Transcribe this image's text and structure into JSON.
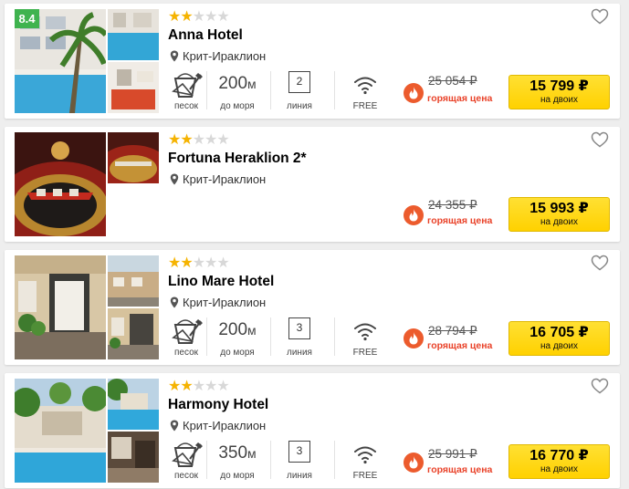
{
  "hotels": [
    {
      "rating": "8.4",
      "stars": 2,
      "name": "Anna Hotel",
      "location": "Крит-Ираклион",
      "beach_label": "песок",
      "sea_value": "200",
      "sea_unit": "м",
      "sea_label": "до моря",
      "line_number": "2",
      "line_label": "линия",
      "wifi_label": "FREE",
      "old_price": "25 054 ₽",
      "hot_label": "горящая цена",
      "price": "15 799 ₽",
      "price_note": "на двоих"
    },
    {
      "rating": "",
      "stars": 2,
      "name": "Fortuna Heraklion 2*",
      "location": "Крит-Ираклион",
      "old_price": "24 355 ₽",
      "hot_label": "горящая цена",
      "price": "15 993 ₽",
      "price_note": "на двоих"
    },
    {
      "rating": "",
      "stars": 2,
      "name": "Lino Mare Hotel",
      "location": "Крит-Ираклион",
      "beach_label": "песок",
      "sea_value": "200",
      "sea_unit": "м",
      "sea_label": "до моря",
      "line_number": "3",
      "line_label": "линия",
      "wifi_label": "FREE",
      "old_price": "28 794 ₽",
      "hot_label": "горящая цена",
      "price": "16 705 ₽",
      "price_note": "на двоих"
    },
    {
      "rating": "",
      "stars": 2,
      "name": "Harmony Hotel",
      "location": "Крит-Ираклион",
      "beach_label": "песок",
      "sea_value": "350",
      "sea_unit": "м",
      "sea_label": "до моря",
      "line_number": "3",
      "line_label": "линия",
      "wifi_label": "FREE",
      "old_price": "25 991 ₽",
      "hot_label": "горящая цена",
      "price": "16 770 ₽",
      "price_note": "на двоих"
    }
  ],
  "icons": {
    "favorite": "heart-icon",
    "location": "map-pin-icon",
    "beach": "sand-bucket-icon",
    "wifi": "wifi-icon",
    "hot": "fire-icon"
  },
  "colors": {
    "rating_badge": "#3fb34f",
    "star": "#f5b301",
    "hot": "#e9432a",
    "price_button": "#ffd100"
  }
}
